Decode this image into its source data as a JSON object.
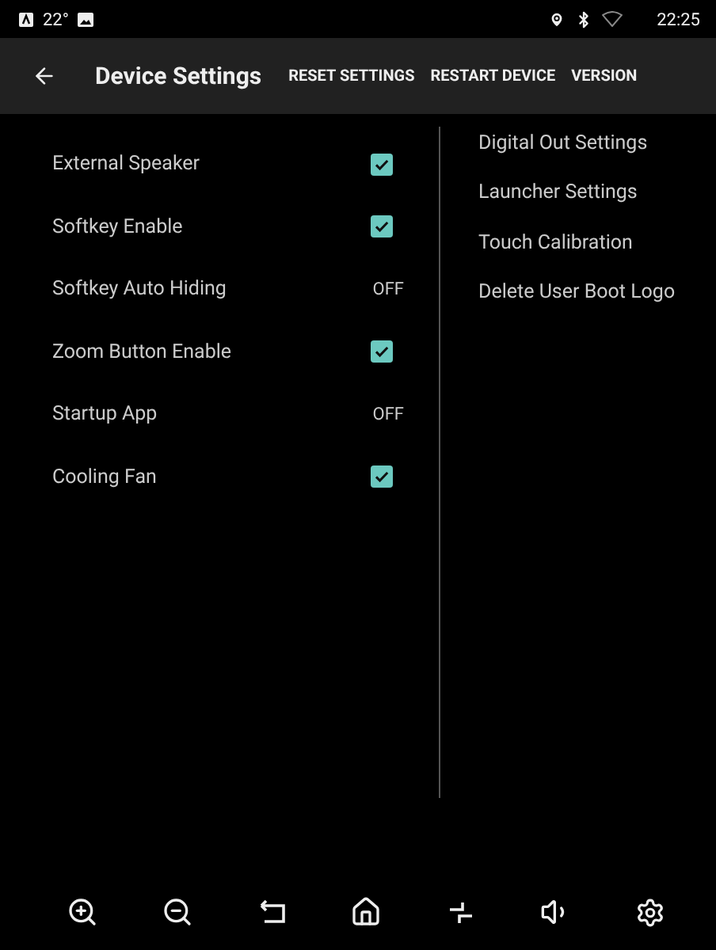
{
  "status_bar": {
    "temperature": "22°",
    "time": "22:25"
  },
  "app_bar": {
    "title": "Device Settings",
    "actions": [
      "RESET SETTINGS",
      "RESTART DEVICE",
      "VERSION"
    ]
  },
  "settings": [
    {
      "label": "External Speaker",
      "kind": "checkbox",
      "checked": true
    },
    {
      "label": "Softkey Enable",
      "kind": "checkbox",
      "checked": true
    },
    {
      "label": "Softkey Auto Hiding",
      "kind": "value",
      "value": "OFF"
    },
    {
      "label": "Zoom Button Enable",
      "kind": "checkbox",
      "checked": true
    },
    {
      "label": "Startup App",
      "kind": "value",
      "value": "OFF"
    },
    {
      "label": "Cooling Fan",
      "kind": "checkbox",
      "checked": true
    }
  ],
  "links": [
    "Digital Out Settings",
    "Launcher Settings",
    "Touch Calibration",
    "Delete User Boot Logo"
  ]
}
